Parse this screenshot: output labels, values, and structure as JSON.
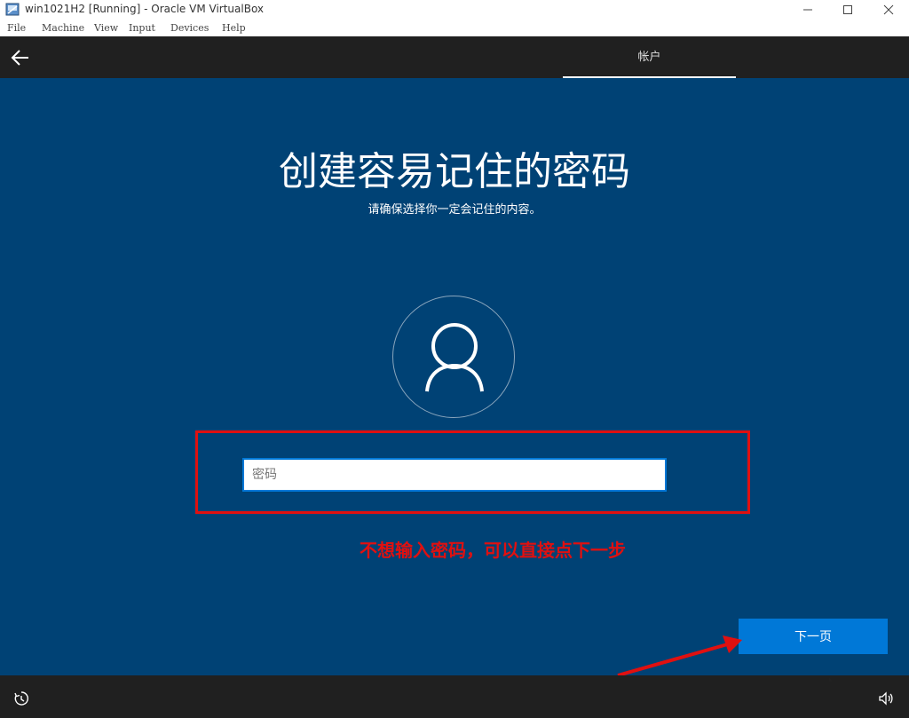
{
  "window": {
    "title": "win1021H2 [Running] - Oracle VM VirtualBox",
    "menu": [
      "File",
      "Machine",
      "View",
      "Input",
      "Devices",
      "Help"
    ]
  },
  "oobe": {
    "tab_label": "帐户",
    "heading": "创建容易记住的密码",
    "subheading": "请确保选择你一定会记住的内容。",
    "password_placeholder": "密码",
    "password_value": "",
    "next_label": "下一页"
  },
  "annotation": {
    "text": "不想输入密码，可以直接点下一步",
    "color": "#e01010"
  },
  "icons": {
    "back": "back-arrow-icon",
    "avatar": "user-icon",
    "ease_of_access": "ease-of-access-icon",
    "volume": "volume-icon"
  },
  "colors": {
    "background": "#004275",
    "bar": "#202020",
    "accent": "#0078d7",
    "annotation": "#e01010"
  }
}
